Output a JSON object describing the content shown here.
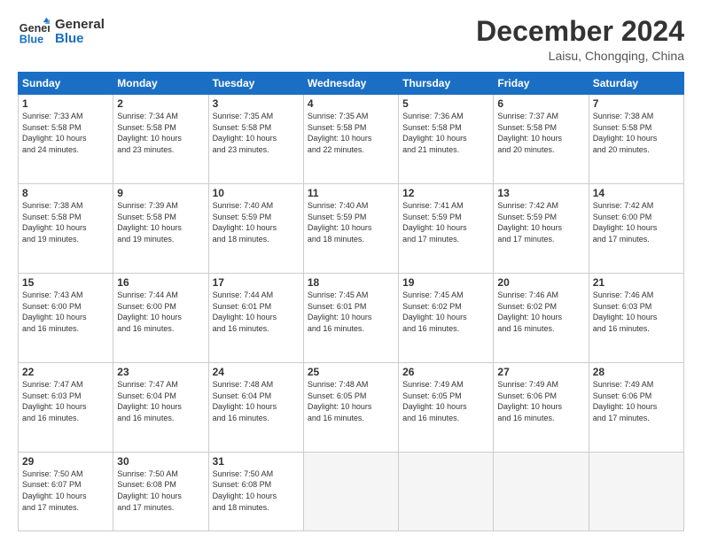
{
  "logo": {
    "line1": "General",
    "line2": "Blue"
  },
  "header": {
    "month": "December 2024",
    "location": "Laisu, Chongqing, China"
  },
  "weekdays": [
    "Sunday",
    "Monday",
    "Tuesday",
    "Wednesday",
    "Thursday",
    "Friday",
    "Saturday"
  ],
  "weeks": [
    [
      {
        "day": "1",
        "info": "Sunrise: 7:33 AM\nSunset: 5:58 PM\nDaylight: 10 hours\nand 24 minutes."
      },
      {
        "day": "2",
        "info": "Sunrise: 7:34 AM\nSunset: 5:58 PM\nDaylight: 10 hours\nand 23 minutes."
      },
      {
        "day": "3",
        "info": "Sunrise: 7:35 AM\nSunset: 5:58 PM\nDaylight: 10 hours\nand 23 minutes."
      },
      {
        "day": "4",
        "info": "Sunrise: 7:35 AM\nSunset: 5:58 PM\nDaylight: 10 hours\nand 22 minutes."
      },
      {
        "day": "5",
        "info": "Sunrise: 7:36 AM\nSunset: 5:58 PM\nDaylight: 10 hours\nand 21 minutes."
      },
      {
        "day": "6",
        "info": "Sunrise: 7:37 AM\nSunset: 5:58 PM\nDaylight: 10 hours\nand 20 minutes."
      },
      {
        "day": "7",
        "info": "Sunrise: 7:38 AM\nSunset: 5:58 PM\nDaylight: 10 hours\nand 20 minutes."
      }
    ],
    [
      {
        "day": "8",
        "info": "Sunrise: 7:38 AM\nSunset: 5:58 PM\nDaylight: 10 hours\nand 19 minutes."
      },
      {
        "day": "9",
        "info": "Sunrise: 7:39 AM\nSunset: 5:58 PM\nDaylight: 10 hours\nand 19 minutes."
      },
      {
        "day": "10",
        "info": "Sunrise: 7:40 AM\nSunset: 5:59 PM\nDaylight: 10 hours\nand 18 minutes."
      },
      {
        "day": "11",
        "info": "Sunrise: 7:40 AM\nSunset: 5:59 PM\nDaylight: 10 hours\nand 18 minutes."
      },
      {
        "day": "12",
        "info": "Sunrise: 7:41 AM\nSunset: 5:59 PM\nDaylight: 10 hours\nand 17 minutes."
      },
      {
        "day": "13",
        "info": "Sunrise: 7:42 AM\nSunset: 5:59 PM\nDaylight: 10 hours\nand 17 minutes."
      },
      {
        "day": "14",
        "info": "Sunrise: 7:42 AM\nSunset: 6:00 PM\nDaylight: 10 hours\nand 17 minutes."
      }
    ],
    [
      {
        "day": "15",
        "info": "Sunrise: 7:43 AM\nSunset: 6:00 PM\nDaylight: 10 hours\nand 16 minutes."
      },
      {
        "day": "16",
        "info": "Sunrise: 7:44 AM\nSunset: 6:00 PM\nDaylight: 10 hours\nand 16 minutes."
      },
      {
        "day": "17",
        "info": "Sunrise: 7:44 AM\nSunset: 6:01 PM\nDaylight: 10 hours\nand 16 minutes."
      },
      {
        "day": "18",
        "info": "Sunrise: 7:45 AM\nSunset: 6:01 PM\nDaylight: 10 hours\nand 16 minutes."
      },
      {
        "day": "19",
        "info": "Sunrise: 7:45 AM\nSunset: 6:02 PM\nDaylight: 10 hours\nand 16 minutes."
      },
      {
        "day": "20",
        "info": "Sunrise: 7:46 AM\nSunset: 6:02 PM\nDaylight: 10 hours\nand 16 minutes."
      },
      {
        "day": "21",
        "info": "Sunrise: 7:46 AM\nSunset: 6:03 PM\nDaylight: 10 hours\nand 16 minutes."
      }
    ],
    [
      {
        "day": "22",
        "info": "Sunrise: 7:47 AM\nSunset: 6:03 PM\nDaylight: 10 hours\nand 16 minutes."
      },
      {
        "day": "23",
        "info": "Sunrise: 7:47 AM\nSunset: 6:04 PM\nDaylight: 10 hours\nand 16 minutes."
      },
      {
        "day": "24",
        "info": "Sunrise: 7:48 AM\nSunset: 6:04 PM\nDaylight: 10 hours\nand 16 minutes."
      },
      {
        "day": "25",
        "info": "Sunrise: 7:48 AM\nSunset: 6:05 PM\nDaylight: 10 hours\nand 16 minutes."
      },
      {
        "day": "26",
        "info": "Sunrise: 7:49 AM\nSunset: 6:05 PM\nDaylight: 10 hours\nand 16 minutes."
      },
      {
        "day": "27",
        "info": "Sunrise: 7:49 AM\nSunset: 6:06 PM\nDaylight: 10 hours\nand 16 minutes."
      },
      {
        "day": "28",
        "info": "Sunrise: 7:49 AM\nSunset: 6:06 PM\nDaylight: 10 hours\nand 17 minutes."
      }
    ],
    [
      {
        "day": "29",
        "info": "Sunrise: 7:50 AM\nSunset: 6:07 PM\nDaylight: 10 hours\nand 17 minutes."
      },
      {
        "day": "30",
        "info": "Sunrise: 7:50 AM\nSunset: 6:08 PM\nDaylight: 10 hours\nand 17 minutes."
      },
      {
        "day": "31",
        "info": "Sunrise: 7:50 AM\nSunset: 6:08 PM\nDaylight: 10 hours\nand 18 minutes."
      },
      {
        "day": "",
        "info": ""
      },
      {
        "day": "",
        "info": ""
      },
      {
        "day": "",
        "info": ""
      },
      {
        "day": "",
        "info": ""
      }
    ]
  ]
}
